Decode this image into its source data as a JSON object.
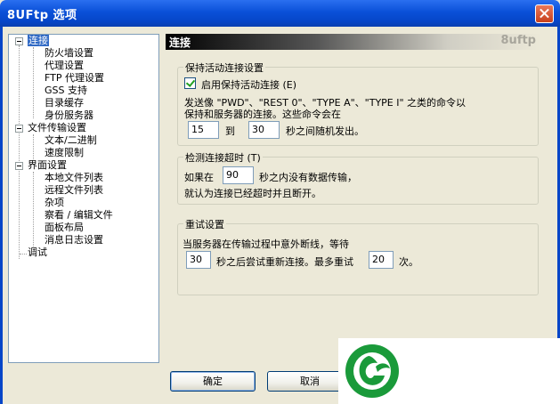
{
  "window": {
    "title": "8UFtp 选项"
  },
  "tree": {
    "items": [
      {
        "label": "连接",
        "selected": true
      },
      {
        "label": "防火墙设置"
      },
      {
        "label": "代理设置"
      },
      {
        "label": "FTP 代理设置"
      },
      {
        "label": "GSS 支持"
      },
      {
        "label": "目录缓存"
      },
      {
        "label": "身份服务器"
      },
      {
        "label": "文件传输设置"
      },
      {
        "label": "文本/二进制"
      },
      {
        "label": "速度限制"
      },
      {
        "label": "界面设置"
      },
      {
        "label": "本地文件列表"
      },
      {
        "label": "远程文件列表"
      },
      {
        "label": "杂项"
      },
      {
        "label": "察看 / 编辑文件"
      },
      {
        "label": "面板布局"
      },
      {
        "label": "消息日志设置"
      },
      {
        "label": "调试"
      }
    ]
  },
  "panel": {
    "title": "连接",
    "brand": "8uftp"
  },
  "keepalive": {
    "legend": "保持活动连接设置",
    "checkbox_label": "启用保持活动连接 (E)",
    "checked": true,
    "desc_line1": "发送像 \"PWD\"、\"REST 0\"、\"TYPE A\"、\"TYPE I\" 之类的命令以",
    "desc_line2": "保持和服务器的连接。这些命令会在",
    "min_value": "15",
    "to_label": "到",
    "max_value": "30",
    "suffix": "秒之间随机发出。"
  },
  "timeout": {
    "legend": "检测连接超时 (T)",
    "prefix": "如果在",
    "value": "90",
    "suffix": "秒之内没有数据传输，",
    "line2": "就认为连接已经超时并且断开。"
  },
  "retry": {
    "legend": "重试设置",
    "line1": "当服务器在传输过程中意外断线，等待",
    "delay_value": "30",
    "middle": "秒之后尝试重新连接。最多重试",
    "count_value": "20",
    "suffix": "次。"
  },
  "buttons": {
    "ok": "确定",
    "cancel": "取消"
  },
  "colors": {
    "titlebar": "#0a50d8",
    "selection": "#316ac5",
    "logo_green": "#1a9a3a"
  }
}
